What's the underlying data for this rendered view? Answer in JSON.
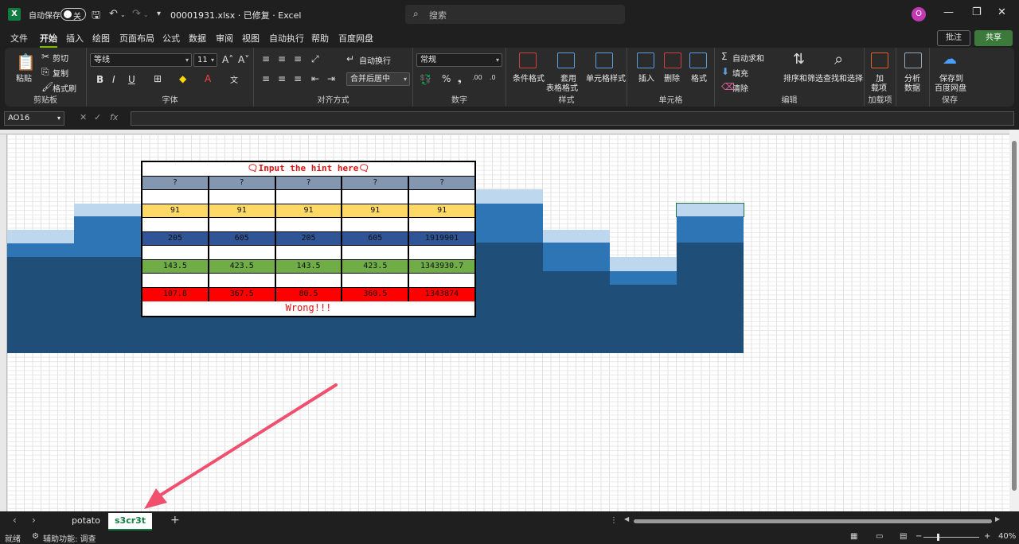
{
  "titlebar": {
    "autosave_label": "自动保存",
    "autosave_state": "关",
    "document_title": "00001931.xlsx · 已修复 · Excel",
    "search_placeholder": "搜索",
    "avatar_initial": "O"
  },
  "menu": {
    "tabs": [
      "文件",
      "开始",
      "插入",
      "绘图",
      "页面布局",
      "公式",
      "数据",
      "审阅",
      "视图",
      "自动执行",
      "帮助",
      "百度网盘"
    ],
    "active_tab": "开始",
    "comment_label": "批注",
    "share_label": "共享"
  },
  "ribbon": {
    "clipboard": {
      "paste": "粘贴",
      "cut": "剪切",
      "copy": "复制",
      "format_painter": "格式刷",
      "label": "剪贴板"
    },
    "font": {
      "font_name": "等线",
      "font_size": "11",
      "label": "字体",
      "bold": "B",
      "italic": "I",
      "underline": "U"
    },
    "alignment": {
      "wrap": "自动换行",
      "merge": "合并后居中",
      "label": "对齐方式"
    },
    "number": {
      "format": "常规",
      "label": "数字"
    },
    "styles": {
      "conditional": "条件格式",
      "table_line1": "套用",
      "table_line2": "表格格式",
      "cell_styles": "单元格样式",
      "label": "样式"
    },
    "cells": {
      "insert": "插入",
      "delete": "删除",
      "format": "格式",
      "label": "单元格"
    },
    "editing": {
      "autosum": "自动求和",
      "fill": "填充",
      "clear": "清除",
      "sort_filter": "排序和筛选",
      "find_select": "查找和选择",
      "label": "编辑"
    },
    "addins": {
      "line1": "加",
      "line2": "载项",
      "label": "加载项"
    },
    "analyze": {
      "line1": "分析",
      "line2": "数据"
    },
    "save_baidu": {
      "line1": "保存到",
      "line2": "百度网盘",
      "label": "保存"
    }
  },
  "formula_bar": {
    "name_box": "AO16",
    "fx": "fx",
    "formula": ""
  },
  "puzzle": {
    "hint": "🗨Input the hint here🗨",
    "rows": [
      {
        "color": "#8497b0",
        "values": [
          "?",
          "?",
          "?",
          "?",
          "?"
        ]
      },
      {
        "color": "#ffffff",
        "values": [
          "",
          "",
          "",
          "",
          ""
        ]
      },
      {
        "color": "#ffd966",
        "values": [
          "91",
          "91",
          "91",
          "91",
          "91"
        ]
      },
      {
        "color": "#ffffff",
        "values": [
          "",
          "",
          "",
          "",
          ""
        ]
      },
      {
        "color": "#2f5597",
        "values": [
          "205",
          "605",
          "205",
          "605",
          "1919901"
        ]
      },
      {
        "color": "#ffffff",
        "values": [
          "",
          "",
          "",
          "",
          ""
        ]
      },
      {
        "color": "#70ad47",
        "values": [
          "143.5",
          "423.5",
          "143.5",
          "423.5",
          "1343930.7"
        ]
      },
      {
        "color": "#ffffff",
        "values": [
          "",
          "",
          "",
          "",
          ""
        ]
      },
      {
        "color": "#ff0000",
        "values": [
          "107.8",
          "367.5",
          "80.5",
          "360.5",
          "1343874"
        ]
      }
    ],
    "result": "Wrong!!!"
  },
  "colors": {
    "light_blue": "#bdd7ee",
    "mid_blue": "#2e75b6",
    "dark_blue": "#1f4e79",
    "annotation_arrow": "#f0506e"
  },
  "sheets": {
    "tabs": [
      "potato",
      "s3cr3t"
    ],
    "active": "s3cr3t"
  },
  "status": {
    "ready": "就绪",
    "accessibility": "辅助功能: 调查",
    "zoom": "40%"
  }
}
